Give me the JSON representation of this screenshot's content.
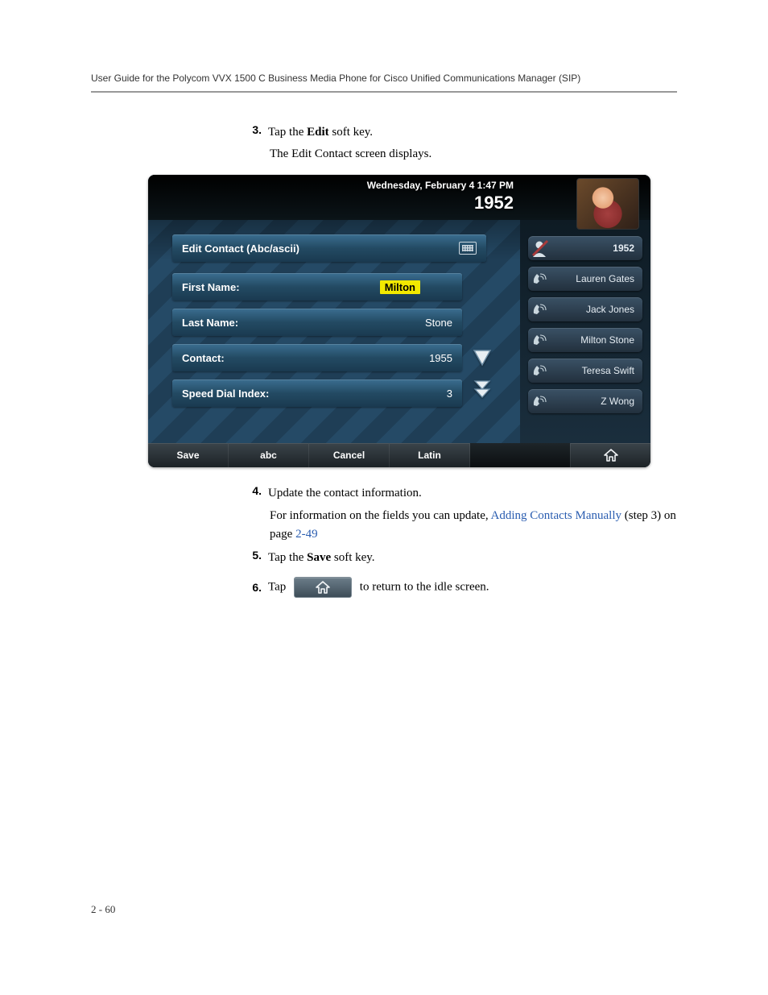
{
  "header": {
    "title": "User Guide for the Polycom VVX 1500 C Business Media Phone for Cisco Unified Communications Manager (SIP)"
  },
  "steps": {
    "s3": {
      "num": "3.",
      "text_a": "Tap the ",
      "bold": "Edit",
      "text_b": " soft key."
    },
    "s3sub": "The Edit Contact screen displays.",
    "s4": {
      "num": "4.",
      "text": "Update the contact information."
    },
    "s4sub_a": "For information on the fields you can update, ",
    "s4link1": "Adding Contacts Manually",
    "s4sub_b": " (step 3) on page ",
    "s4link2": "2-49",
    "s5": {
      "num": "5.",
      "text_a": "Tap the ",
      "bold": "Save",
      "text_b": " soft key."
    },
    "s6": {
      "num": "6.",
      "text_a": "Tap ",
      "text_b": " to return to the idle screen."
    }
  },
  "device": {
    "datetime": "Wednesday, February 4  1:47 PM",
    "extension": "1952",
    "panel_title": "Edit Contact (Abc/ascii)",
    "fields": {
      "first_name_label": "First Name:",
      "first_name_value": "Milton",
      "last_name_label": "Last Name:",
      "last_name_value": "Stone",
      "contact_label": "Contact:",
      "contact_value": "1955",
      "speed_label": "Speed Dial Index:",
      "speed_value": "3"
    },
    "side": {
      "ext": "1952",
      "contacts": [
        "Lauren Gates",
        "Jack Jones",
        "Milton Stone",
        "Teresa Swift",
        "Z Wong"
      ]
    },
    "softkeys": [
      "Save",
      "abc",
      "Cancel",
      "Latin"
    ]
  },
  "footer": "2 - 60"
}
